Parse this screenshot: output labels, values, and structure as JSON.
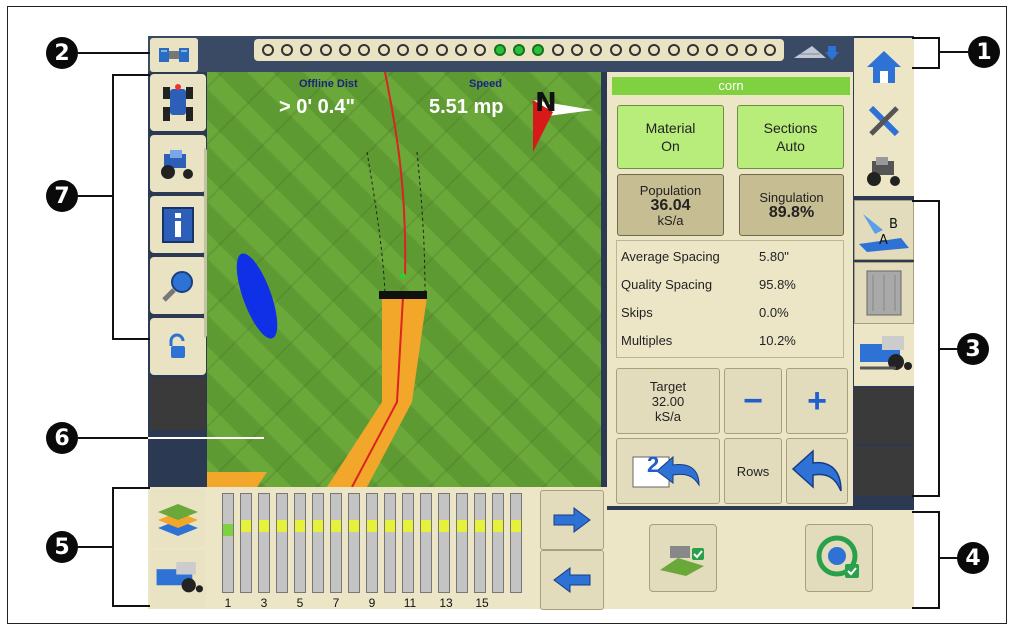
{
  "callouts": [
    "1",
    "2",
    "3",
    "4",
    "5",
    "6",
    "7"
  ],
  "map": {
    "offline_label": "Offline Dist",
    "offline_value": "> 0' 0.4\"",
    "speed_label": "Speed",
    "speed_value": "5.51 mp",
    "compass": "N"
  },
  "panel": {
    "crop": "corn",
    "material_line1": "Material",
    "material_line2": "On",
    "sections_line1": "Sections",
    "sections_line2": "Auto",
    "population_label": "Population",
    "population_value": "36.04",
    "population_unit": "kS/a",
    "singulation_label": "Singulation",
    "singulation_value": "89.8%",
    "stats": [
      {
        "label": "Average Spacing",
        "value": "5.80\""
      },
      {
        "label": "Quality Spacing",
        "value": "95.8%"
      },
      {
        "label": "Skips",
        "value": "0.0%"
      },
      {
        "label": "Multiples",
        "value": "10.2%"
      }
    ],
    "target_label": "Target",
    "target_value": "32.00",
    "target_unit": "kS/a",
    "minus": "−",
    "plus": "+",
    "badge": "2",
    "rows_label": "Rows"
  },
  "row_numbers": [
    "1",
    "3",
    "5",
    "7",
    "9",
    "11",
    "13",
    "15"
  ],
  "colors": {
    "accent_green": "#7fd140",
    "button_green": "#b8ec7b",
    "coverage": "#f2a62a"
  }
}
